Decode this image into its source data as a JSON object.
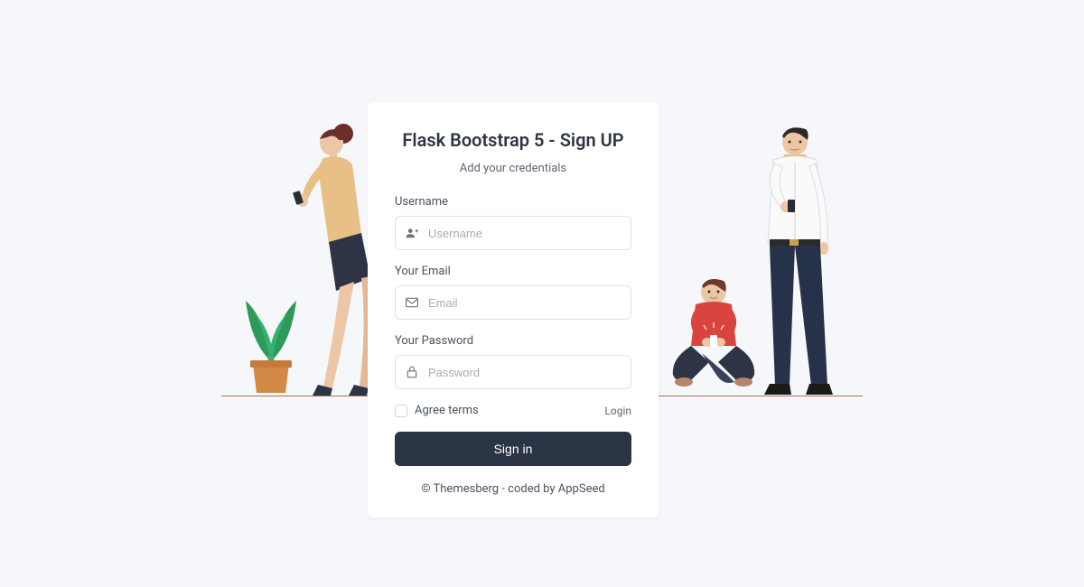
{
  "title": "Flask Bootstrap 5 - Sign UP",
  "subtitle": "Add your credentials",
  "form": {
    "username_label": "Username",
    "username_placeholder": "Username",
    "email_label": "Your Email",
    "email_placeholder": "Email",
    "password_label": "Your Password",
    "password_placeholder": "Password",
    "agree_label": "Agree terms",
    "login_link": "Login",
    "submit_label": "Sign in"
  },
  "footer": {
    "copyright": "©",
    "brand": "Themesberg",
    "middle": " - coded by ",
    "coded_by": "AppSeed"
  }
}
